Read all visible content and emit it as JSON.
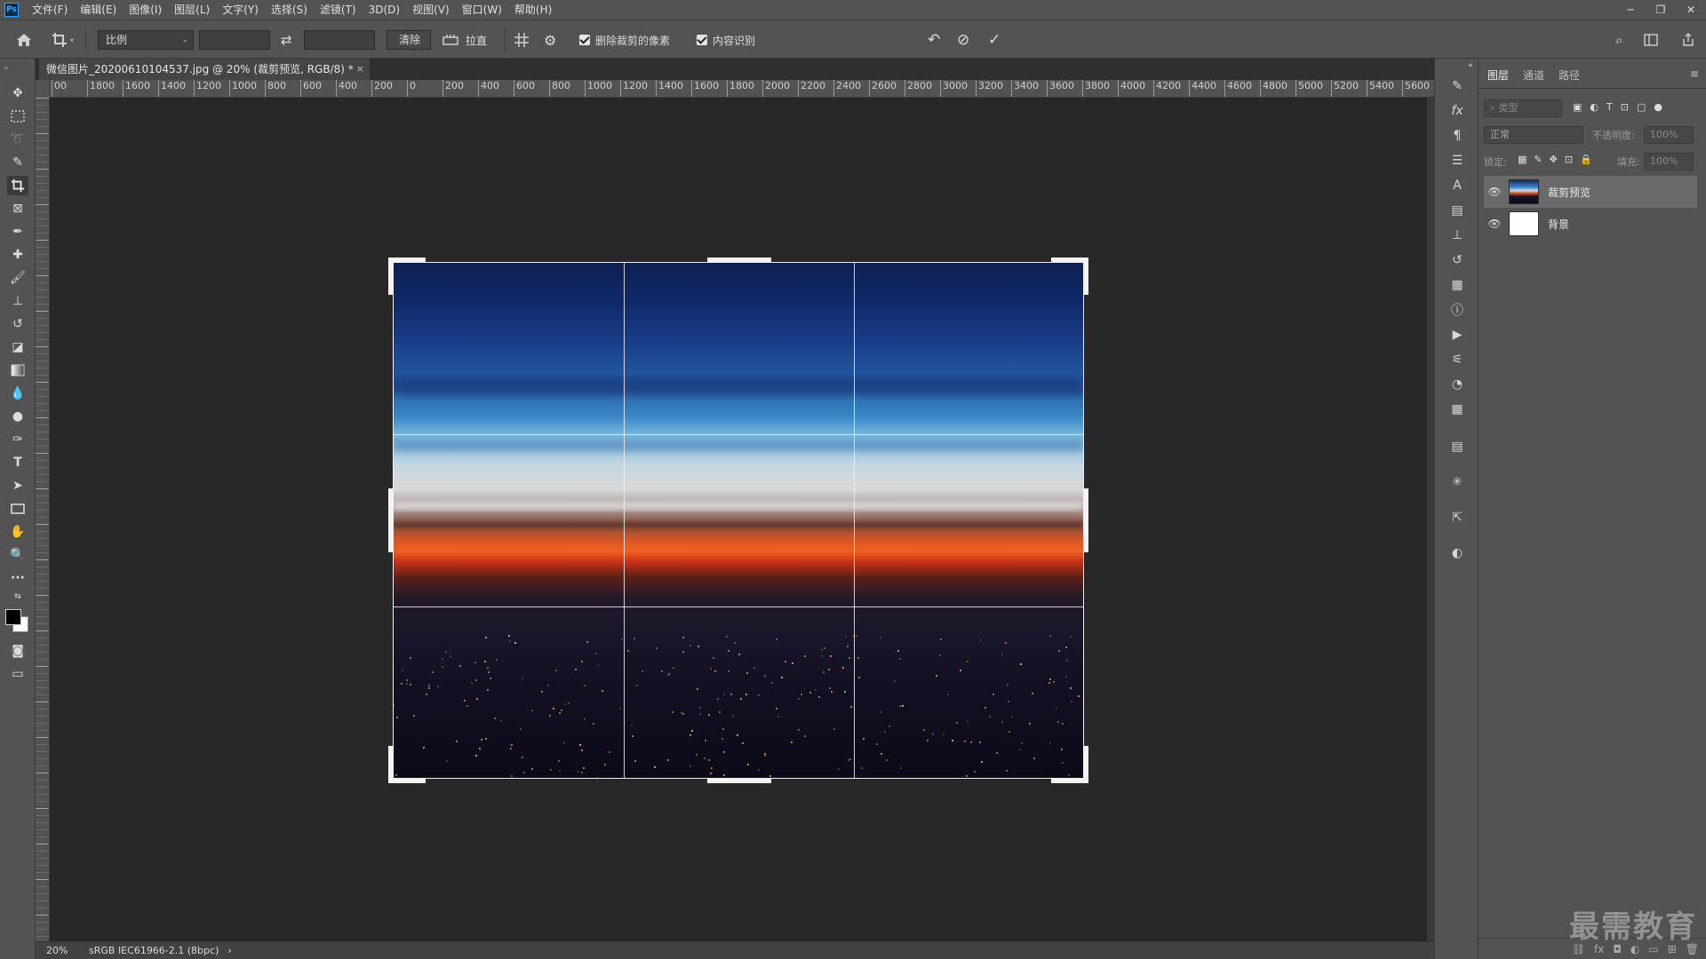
{
  "app": {
    "logo": "Ps",
    "menu": [
      "文件(F)",
      "编辑(E)",
      "图像(I)",
      "图层(L)",
      "文字(Y)",
      "选择(S)",
      "滤镜(T)",
      "3D(D)",
      "视图(V)",
      "窗口(W)",
      "帮助(H)"
    ],
    "window_controls": [
      "─",
      "❐",
      "✕"
    ]
  },
  "options": {
    "ratio_select": "比例",
    "clear_label": "清除",
    "straighten_label": "拉直",
    "delete_pixels_label": "删除裁剪的像素",
    "content_aware_label": "内容识别"
  },
  "document": {
    "tab_title": "微信图片_20200610104537.jpg @ 20% (裁剪预览, RGB/8) *",
    "close": "×"
  },
  "ruler": {
    "top": [
      "00",
      "1800",
      "1600",
      "1400",
      "1200",
      "1000",
      "800",
      "600",
      "400",
      "200",
      "0",
      "200",
      "400",
      "600",
      "800",
      "1000",
      "1200",
      "1400",
      "1600",
      "1800",
      "2000",
      "2200",
      "2400",
      "2600",
      "2800",
      "3000",
      "3200",
      "3400",
      "3600",
      "3800",
      "4000",
      "4200",
      "4400",
      "4600",
      "4800",
      "5000",
      "5200",
      "5400",
      "5600"
    ]
  },
  "status": {
    "zoom": "20%",
    "profile": "sRGB IEC61966-2.1 (8bpc)",
    "arrow": "›"
  },
  "panels": {
    "tabs": [
      "图层",
      "通道",
      "路径"
    ],
    "filter_placeholder": "类型",
    "blend_mode": "正常",
    "opacity_label": "不透明度:",
    "opacity_value": "100%",
    "lock_label": "锁定:",
    "fill_label": "填充:",
    "fill_value": "100%",
    "layers": [
      {
        "name": "裁剪预览",
        "selected": true
      },
      {
        "name": "背景",
        "selected": false
      }
    ]
  },
  "watermark": "最需教育",
  "colors": {
    "foreground": "#000000",
    "background": "#ffffff",
    "ui_panel": "#535353",
    "canvas_bg": "#282828"
  }
}
